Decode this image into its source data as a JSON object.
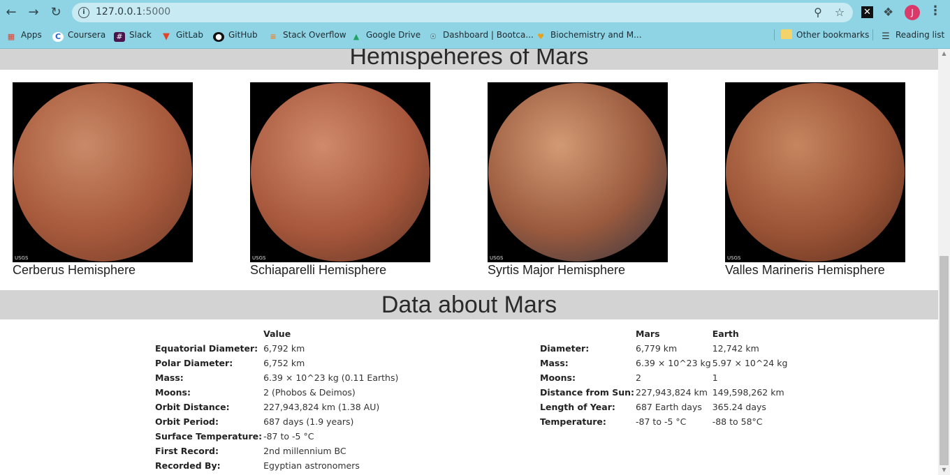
{
  "browser": {
    "url_host": "127.0.0.1",
    "url_port": ":5000",
    "avatar_letter": "J",
    "bookmarks": [
      {
        "label": "Apps",
        "icon": "apps-grid-icon"
      },
      {
        "label": "Coursera",
        "icon": "coursera-icon"
      },
      {
        "label": "Slack",
        "icon": "slack-icon"
      },
      {
        "label": "GitLab",
        "icon": "gitlab-icon"
      },
      {
        "label": "GitHub",
        "icon": "github-icon"
      },
      {
        "label": "Stack Overflow",
        "icon": "stackoverflow-icon"
      },
      {
        "label": "Google Drive",
        "icon": "google-drive-icon"
      },
      {
        "label": "Dashboard | Bootca...",
        "icon": "globe-icon"
      },
      {
        "label": "Biochemistry and M...",
        "icon": "bookmark-favicon-icon"
      },
      {
        "label": "Other bookmarks",
        "icon": "folder-icon"
      },
      {
        "label": "Reading list",
        "icon": "reading-list-icon"
      }
    ]
  },
  "hemispheres": {
    "heading": "Hemispeheres of Mars",
    "items": [
      {
        "title": "Cerberus Hemisphere",
        "logo": "USGS",
        "colors": [
          "#c98a68",
          "#a85a3c",
          "#6e3a28"
        ]
      },
      {
        "title": "Schiaparelli Hemisphere",
        "logo": "USGS",
        "colors": [
          "#d08a6c",
          "#a8583c",
          "#5e3324"
        ]
      },
      {
        "title": "Syrtis Major Hemisphere",
        "logo": "USGS",
        "colors": [
          "#d29a74",
          "#9a5a3e",
          "#2f3340"
        ]
      },
      {
        "title": "Valles Marineris Hemisphere",
        "logo": "USGS",
        "colors": [
          "#c6855f",
          "#9c5436",
          "#5a2e1e"
        ]
      }
    ]
  },
  "facts": {
    "heading": "Data about Mars",
    "table1": {
      "header": [
        "",
        "Value"
      ],
      "rows": [
        [
          "Equatorial Diameter:",
          "6,792 km"
        ],
        [
          "Polar Diameter:",
          "6,752 km"
        ],
        [
          "Mass:",
          "6.39 × 10^23 kg (0.11 Earths)"
        ],
        [
          "Moons:",
          "2 (Phobos & Deimos)"
        ],
        [
          "Orbit Distance:",
          "227,943,824 km (1.38 AU)"
        ],
        [
          "Orbit Period:",
          "687 days (1.9 years)"
        ],
        [
          "Surface Temperature:",
          "-87 to -5 °C"
        ],
        [
          "First Record:",
          "2nd millennium BC"
        ],
        [
          "Recorded By:",
          "Egyptian astronomers"
        ]
      ]
    },
    "table2": {
      "header": [
        "",
        "Mars",
        "Earth"
      ],
      "rows": [
        [
          "Diameter:",
          "6,779 km",
          "12,742 km"
        ],
        [
          "Mass:",
          "6.39 × 10^23 kg",
          "5.97 × 10^24 kg"
        ],
        [
          "Moons:",
          "2",
          "1"
        ],
        [
          "Distance from Sun:",
          "227,943,824 km",
          "149,598,262 km"
        ],
        [
          "Length of Year:",
          "687 Earth days",
          "365.24 days"
        ],
        [
          "Temperature:",
          "-87 to -5 °C",
          "-88 to 58°C"
        ]
      ]
    }
  }
}
